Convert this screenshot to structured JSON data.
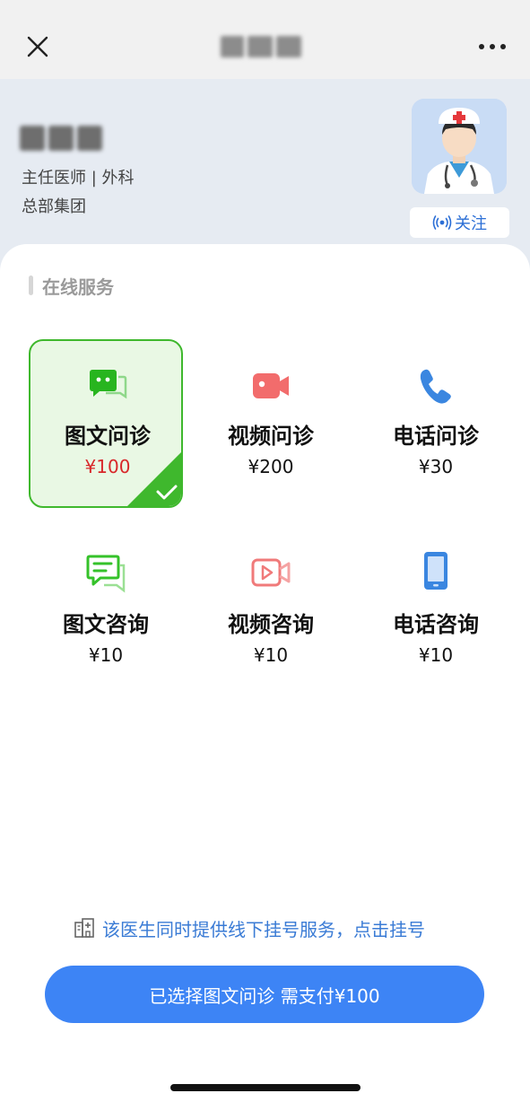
{
  "nav": {
    "close_icon": "close-icon",
    "more_icon": "more-icon"
  },
  "doctor": {
    "title_dept": "主任医师 | 外科",
    "org": "总部集团",
    "follow_label": "关注"
  },
  "section": {
    "label": "在线服务"
  },
  "services": [
    {
      "name": "图文问诊",
      "price": "¥100",
      "icon": "chat-bubbles-icon",
      "selected": true
    },
    {
      "name": "视频问诊",
      "price": "¥200",
      "icon": "video-camera-icon",
      "selected": false
    },
    {
      "name": "电话问诊",
      "price": "¥30",
      "icon": "phone-icon",
      "selected": false
    },
    {
      "name": "图文咨询",
      "price": "¥10",
      "icon": "chat-lines-icon",
      "selected": false
    },
    {
      "name": "视频咨询",
      "price": "¥10",
      "icon": "video-play-icon",
      "selected": false
    },
    {
      "name": "电话咨询",
      "price": "¥10",
      "icon": "mobile-phone-icon",
      "selected": false
    }
  ],
  "offline": {
    "text": "该医生同时提供线下挂号服务，点击挂号"
  },
  "pay_button": {
    "label": "已选择图文问诊 需支付¥100"
  },
  "colors": {
    "accent_blue": "#3d84f5",
    "selected_green": "#3fb82d",
    "price_red": "#d8282a"
  }
}
